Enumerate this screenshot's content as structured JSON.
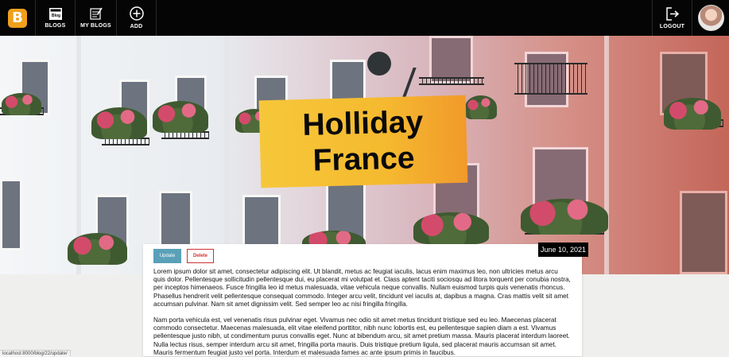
{
  "navbar": {
    "brand_letter": "B",
    "items": [
      {
        "label": "BLOGS",
        "icon": "blog-icon"
      },
      {
        "label": "MY BLOGS",
        "icon": "my-blogs-icon"
      },
      {
        "label": "ADD",
        "icon": "add-icon"
      }
    ],
    "logout_label": "LOGOUT",
    "blog_icon_text": "Blog"
  },
  "hero": {
    "title_line1": "Holliday",
    "title_line2": "France",
    "date": "June 10, 2021"
  },
  "actions": {
    "update_label": "Update",
    "delete_label": "Delete"
  },
  "content": {
    "paragraph1": "Lorem ipsum dolor sit amet, consectetur adipiscing elit. Ut blandit, metus ac feugiat iaculis, lacus enim maximus leo, non ultricies metus arcu quis dolor. Pellentesque sollicitudin pellentesque dui, eu placerat mi volutpat et. Class aptent taciti sociosqu ad litora torquent per conubia nostra, per inceptos himenaeos. Fusce fringilla leo id metus malesuada, vitae vehicula neque convallis. Nullam euismod turpis quis venenatis rhoncus. Phasellus hendrerit velit pellentesque consequat commodo. Integer arcu velit, tincidunt vel iaculis at, dapibus a magna. Cras mattis velit sit amet accumsan pulvinar. Nam sit amet dignissim velit. Sed semper leo ac nisi fringilla fringilla.",
    "paragraph2": "Nam porta vehicula est, vel venenatis risus pulvinar eget. Vivamus nec odio sit amet metus tincidunt tristique sed eu leo. Maecenas placerat commodo consectetur. Maecenas malesuada, elit vitae eleifend porttitor, nibh nunc lobortis est, eu pellentesque sapien diam a est. Vivamus pellentesque justo nibh, ut condimentum purus convallis eget. Nunc at bibendum arcu, sit amet pretium massa. Mauris placerat interdum laoreet. Nulla lectus risus, semper interdum arcu sit amet, fringilla porta mauris. Duis tristique pretium ligula, sed placerat mauris accumsan sit amet. Mauris fermentum feugiat justo vel porta. Interdum et malesuada fames ac ante ipsum primis in faucibus."
  },
  "status_bar": {
    "url": "localhost:8000/blog/22/update/"
  }
}
